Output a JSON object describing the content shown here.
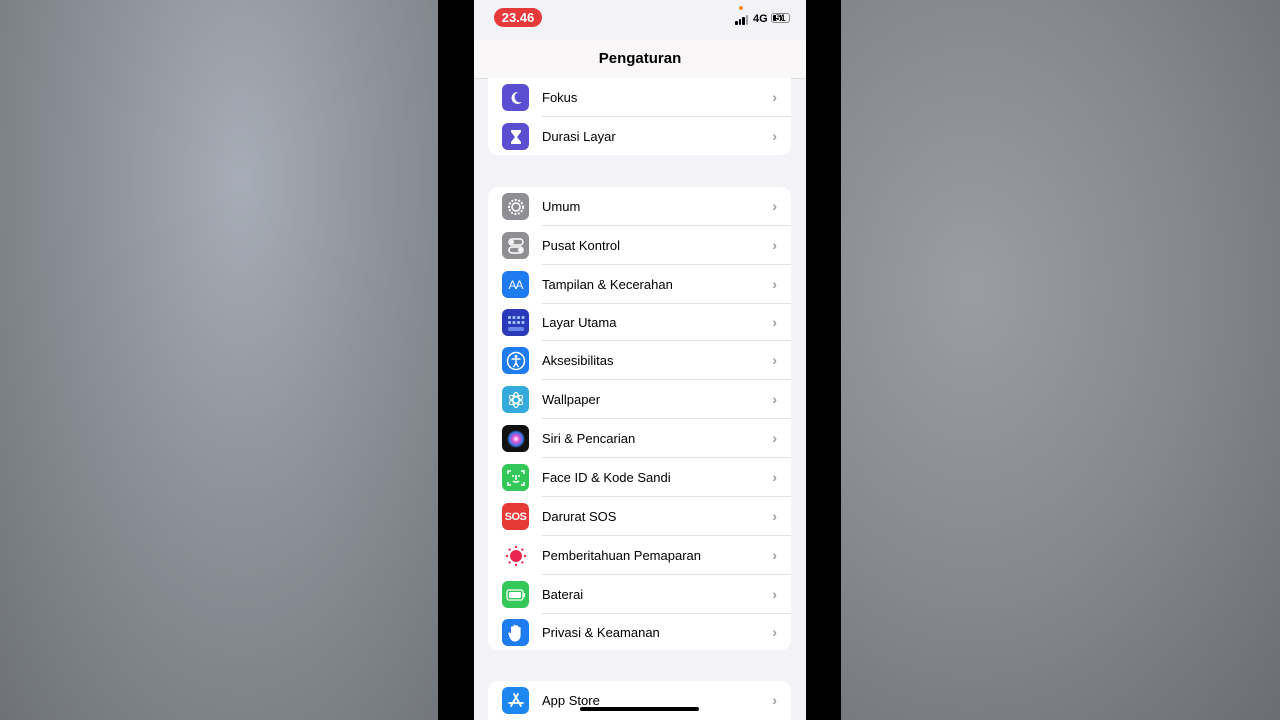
{
  "status": {
    "time": "23.46",
    "network": "4G",
    "battery": "51"
  },
  "nav": {
    "title": "Pengaturan"
  },
  "group1": [
    {
      "label": "Fokus",
      "icon": "moon-icon",
      "color": "#5b4fd1"
    },
    {
      "label": "Durasi Layar",
      "icon": "hourglass-icon",
      "color": "#5b4fd1"
    }
  ],
  "group2": [
    {
      "label": "Umum",
      "icon": "gear-icon",
      "color": "#8e8e93"
    },
    {
      "label": "Pusat Kontrol",
      "icon": "toggles-icon",
      "color": "#8e8e93"
    },
    {
      "label": "Tampilan & Kecerahan",
      "icon": "text-size-icon",
      "color": "#1e7bf0"
    },
    {
      "label": "Layar Utama",
      "icon": "home-grid-icon",
      "color": "#2b3ab8"
    },
    {
      "label": "Aksesibilitas",
      "icon": "accessibility-icon",
      "color": "#1e7bf0"
    },
    {
      "label": "Wallpaper",
      "icon": "flower-icon",
      "color": "#35aadc"
    },
    {
      "label": "Siri & Pencarian",
      "icon": "siri-icon",
      "color": "#111111"
    },
    {
      "label": "Face ID & Kode Sandi",
      "icon": "face-id-icon",
      "color": "#34c759"
    },
    {
      "label": "Darurat SOS",
      "icon": "sos-icon",
      "color": "#e53935"
    },
    {
      "label": "Pemberitahuan Pemaparan",
      "icon": "exposure-icon",
      "color": "#ffffff"
    },
    {
      "label": "Baterai",
      "icon": "battery-icon",
      "color": "#34c759"
    },
    {
      "label": "Privasi & Keamanan",
      "icon": "hand-icon",
      "color": "#1e7bf0"
    }
  ],
  "group3": [
    {
      "label": "App Store",
      "icon": "app-store-icon",
      "color": "#1e88f0"
    }
  ],
  "sos_text": "SOS",
  "font_glyph": "AA"
}
